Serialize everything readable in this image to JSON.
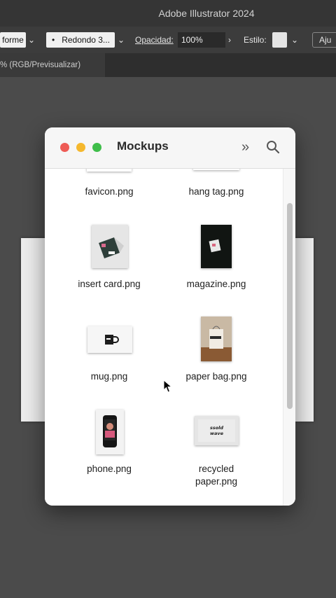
{
  "app": {
    "title": "Adobe Illustrator 2024"
  },
  "control_bar": {
    "shape_field": "forme",
    "brush_dot": "•",
    "brush_label": "Redondo 3...",
    "opacity_label": "Opacidad:",
    "opacity_value": "100%",
    "style_label": "Estilo:",
    "adjust_label": "Aju"
  },
  "document_tab": {
    "label": "% (RGB/Previsualizar)"
  },
  "window": {
    "title": "Mockups",
    "more_glyph": "»",
    "files": [
      {
        "label": "favicon.png"
      },
      {
        "label": "hang tag.png"
      },
      {
        "label": "insert card.png"
      },
      {
        "label": "magazine.png"
      },
      {
        "label": "mug.png"
      },
      {
        "label": "paper bag.png"
      },
      {
        "label": "phone.png"
      },
      {
        "label": "recycled paper.png",
        "line1": "recycled",
        "line2": "paper.png"
      }
    ],
    "recycled_thumb_text": "ssold wave"
  },
  "colors": {
    "close": "#ee5b55",
    "minimize": "#f5b82e",
    "zoom": "#3fbe4a",
    "canvas_bg": "#4b4b4b"
  }
}
